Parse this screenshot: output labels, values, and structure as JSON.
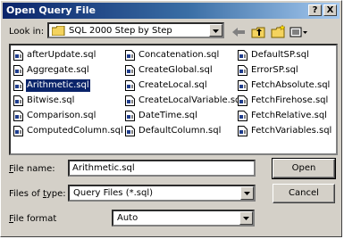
{
  "window": {
    "title": "Open Query File",
    "help_label": "?",
    "close_label": "X"
  },
  "look_in": {
    "label": "Look in:",
    "value": "SQL 2000 Step by Step"
  },
  "toolbar": {
    "icons": [
      "back-icon",
      "up-folder-icon",
      "new-folder-icon",
      "view-menu-icon"
    ]
  },
  "files": {
    "col1": [
      "afterUpdate.sql",
      "Aggregate.sql",
      "Arithmetic.sql",
      "Bitwise.sql",
      "Comparison.sql",
      "ComputedColumn.sql"
    ],
    "col2": [
      "Concatenation.sql",
      "CreateGlobal.sql",
      "CreateLocal.sql",
      "CreateLocalVariable.sql",
      "DateTime.sql",
      "DefaultColumn.sql"
    ],
    "col3": [
      "DefaultSP.sql",
      "ErrorSP.sql",
      "FetchAbsolute.sql",
      "FetchFirehose.sql",
      "FetchRelative.sql",
      "FetchVariables.sql"
    ],
    "selected": "Arithmetic.sql"
  },
  "file_name": {
    "label": "File name:",
    "value": "Arithmetic.sql"
  },
  "file_type": {
    "label": "Files of type:",
    "value": "Query Files (*.sql)"
  },
  "file_format": {
    "label": "File format",
    "value": "Auto"
  },
  "buttons": {
    "open": "Open",
    "cancel": "Cancel"
  },
  "colors": {
    "title_start": "#0a246a",
    "title_end": "#a6caf0",
    "face": "#d4d0c8",
    "selection": "#0a246a"
  }
}
